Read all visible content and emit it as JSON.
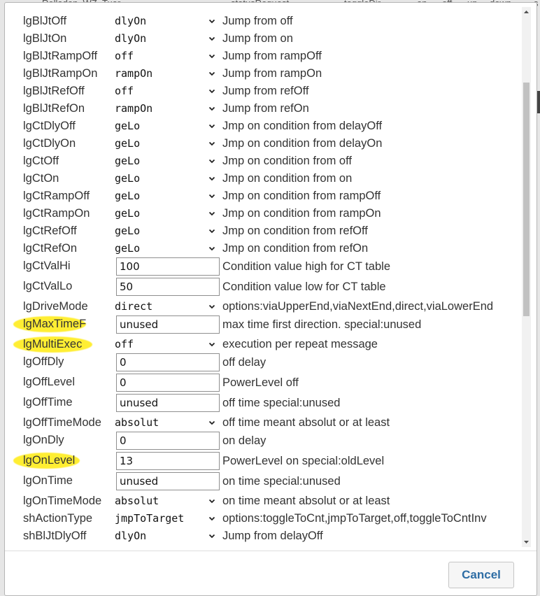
{
  "background": {
    "tabs": [
      "Rolladen_WZ_Tuer",
      "statusRequest",
      "toggleDir",
      "on",
      "off",
      "up",
      "down",
      "s"
    ]
  },
  "highlight_color": "#ffee33",
  "accent_color": "#2e6da4",
  "rows": [
    {
      "name": "lgBlJtOff",
      "kind": "select",
      "value": "dlyOn",
      "desc": "Jump from off"
    },
    {
      "name": "lgBlJtOn",
      "kind": "select",
      "value": "dlyOn",
      "desc": "Jump from on"
    },
    {
      "name": "lgBlJtRampOff",
      "kind": "select",
      "value": "off",
      "desc": "Jump from rampOff"
    },
    {
      "name": "lgBlJtRampOn",
      "kind": "select",
      "value": "rampOn",
      "desc": "Jump from rampOn"
    },
    {
      "name": "lgBlJtRefOff",
      "kind": "select",
      "value": "off",
      "desc": "Jump from refOff"
    },
    {
      "name": "lgBlJtRefOn",
      "kind": "select",
      "value": "rampOn",
      "desc": "Jump from refOn"
    },
    {
      "name": "lgCtDlyOff",
      "kind": "select",
      "value": "geLo",
      "desc": "Jmp on condition from delayOff"
    },
    {
      "name": "lgCtDlyOn",
      "kind": "select",
      "value": "geLo",
      "desc": "Jmp on condition from delayOn"
    },
    {
      "name": "lgCtOff",
      "kind": "select",
      "value": "geLo",
      "desc": "Jmp on condition from off"
    },
    {
      "name": "lgCtOn",
      "kind": "select",
      "value": "geLo",
      "desc": "Jmp on condition from on"
    },
    {
      "name": "lgCtRampOff",
      "kind": "select",
      "value": "geLo",
      "desc": "Jmp on condition from rampOff"
    },
    {
      "name": "lgCtRampOn",
      "kind": "select",
      "value": "geLo",
      "desc": "Jmp on condition from rampOn"
    },
    {
      "name": "lgCtRefOff",
      "kind": "select",
      "value": "geLo",
      "desc": "Jmp on condition from refOff"
    },
    {
      "name": "lgCtRefOn",
      "kind": "select",
      "value": "geLo",
      "desc": "Jmp on condition from refOn"
    },
    {
      "name": "lgCtValHi",
      "kind": "input",
      "value": "100",
      "desc": "Condition value high for CT table"
    },
    {
      "name": "lgCtValLo",
      "kind": "input",
      "value": "50",
      "desc": "Condition value low for CT table"
    },
    {
      "name": "lgDriveMode",
      "kind": "select",
      "value": "direct",
      "desc": "options:viaUpperEnd,viaNextEnd,direct,viaLowerEnd"
    },
    {
      "name": "lgMaxTimeF",
      "kind": "input",
      "value": "unused",
      "desc": "max time first direction. special:unused",
      "highlight": true
    },
    {
      "name": "lgMultiExec",
      "kind": "select",
      "value": "off",
      "desc": "execution per repeat message",
      "highlight": true
    },
    {
      "name": "lgOffDly",
      "kind": "input",
      "value": "0",
      "desc": "off delay"
    },
    {
      "name": "lgOffLevel",
      "kind": "input",
      "value": "0",
      "desc": "PowerLevel off"
    },
    {
      "name": "lgOffTime",
      "kind": "input",
      "value": "unused",
      "desc": "off time special:unused"
    },
    {
      "name": "lgOffTimeMode",
      "kind": "select",
      "value": "absolut",
      "desc": "off time meant absolut or at least"
    },
    {
      "name": "lgOnDly",
      "kind": "input",
      "value": "0",
      "desc": "on delay"
    },
    {
      "name": "lgOnLevel",
      "kind": "input",
      "value": "13",
      "desc": "PowerLevel on special:oldLevel",
      "highlight": true
    },
    {
      "name": "lgOnTime",
      "kind": "input",
      "value": "unused",
      "desc": "on time special:unused"
    },
    {
      "name": "lgOnTimeMode",
      "kind": "select",
      "value": "absolut",
      "desc": "on time meant absolut or at least"
    },
    {
      "name": "shActionType",
      "kind": "select",
      "value": "jmpToTarget",
      "desc": "options:toggleToCnt,jmpToTarget,off,toggleToCntInv"
    },
    {
      "name": "shBlJtDlyOff",
      "kind": "select",
      "value": "dlyOn",
      "desc": "Jump from delayOff"
    }
  ],
  "footer": {
    "cancel_label": "Cancel"
  }
}
